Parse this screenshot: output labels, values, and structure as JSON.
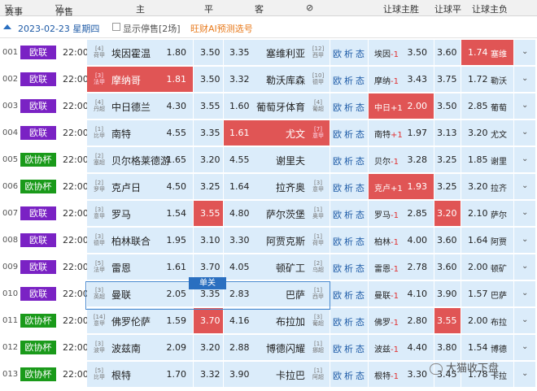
{
  "header": {
    "league": "赛事",
    "stop": "停售",
    "home": "主",
    "draw": "平",
    "away": "客",
    "handicap_col": "⊘",
    "hh_win": "让球主胜",
    "hh_draw": "让球平",
    "hh_lose": "让球主负"
  },
  "datebar": {
    "date": "2023-02-23 星期四",
    "show_stopped": "显示停售[2场]",
    "prediction": "旺财AI预测选号"
  },
  "single_label": "单关",
  "links": {
    "a": "欧",
    "b": "析",
    "c": "态"
  },
  "watermark": "大猫收下盘",
  "matches": [
    {
      "idx": "001",
      "league": "欧联",
      "time": "22:00",
      "home_rank": "[4]",
      "home_league": "荷甲",
      "home": "埃因霍温",
      "home_odd": "1.80",
      "draw": "3.50",
      "away": "塞维利亚",
      "away_odd": "3.35",
      "away_rank": "[12]",
      "away_league": "西甲",
      "h_team": "埃因",
      "h_hcap": "-1",
      "hh": "3.50",
      "hd": "3.60",
      "ha": "1.74",
      "h_away": "塞维"
    },
    {
      "idx": "002",
      "league": "欧联",
      "time": "22:00",
      "home_rank": "[3]",
      "home_league": "法甲",
      "home": "摩纳哥",
      "home_odd": "1.81",
      "draw": "3.50",
      "away": "勒沃库森",
      "away_odd": "3.32",
      "away_rank": "[10]",
      "away_league": "德甲",
      "h_team": "摩纳",
      "h_hcap": "-1",
      "hh": "3.43",
      "hd": "3.75",
      "ha": "1.72",
      "h_away": "勒沃"
    },
    {
      "idx": "003",
      "league": "欧联",
      "time": "22:00",
      "home_rank": "[4]",
      "home_league": "丹超",
      "home": "中日德兰",
      "home_odd": "4.30",
      "draw": "3.55",
      "away": "葡萄牙体育",
      "away_odd": "1.60",
      "away_rank": "[4]",
      "away_league": "葡超",
      "h_team": "中日",
      "h_hcap": "+1",
      "hh": "2.00",
      "hd": "3.50",
      "ha": "2.85",
      "h_away": "葡萄"
    },
    {
      "idx": "004",
      "league": "欧联",
      "time": "22:00",
      "home_rank": "[1]",
      "home_league": "比甲",
      "home": "南特",
      "home_odd": "4.55",
      "draw": "3.35",
      "away": "尤文",
      "away_odd": "1.61",
      "away_rank": "[7]",
      "away_league": "意甲",
      "h_team": "南特",
      "h_hcap": "+1",
      "hh": "1.97",
      "hd": "3.13",
      "ha": "3.20",
      "h_away": "尤文"
    },
    {
      "idx": "005",
      "league": "欧协杯",
      "time": "22:00",
      "home_rank": "[2]",
      "home_league": "塞超",
      "home": "贝尔格莱德游",
      "home_odd": "1.65",
      "draw": "3.20",
      "away": "谢里夫",
      "away_odd": "4.55",
      "away_rank": "",
      "away_league": "",
      "h_team": "贝尔",
      "h_hcap": "-1",
      "hh": "3.28",
      "hd": "3.25",
      "ha": "1.85",
      "h_away": "谢里"
    },
    {
      "idx": "006",
      "league": "欧协杯",
      "time": "22:00",
      "home_rank": "[2]",
      "home_league": "罗甲",
      "home": "克卢日",
      "home_odd": "4.50",
      "draw": "3.25",
      "away": "拉齐奥",
      "away_odd": "1.64",
      "away_rank": "[3]",
      "away_league": "意甲",
      "h_team": "克卢",
      "h_hcap": "+1",
      "hh": "1.93",
      "hd": "3.25",
      "ha": "3.20",
      "h_away": "拉齐"
    },
    {
      "idx": "007",
      "league": "欧联",
      "time": "22:00",
      "home_rank": "[3]",
      "home_league": "意甲",
      "home": "罗马",
      "home_odd": "1.54",
      "draw": "3.55",
      "away": "萨尔茨堡",
      "away_odd": "4.80",
      "away_rank": "[1]",
      "away_league": "奥甲",
      "h_team": "罗马",
      "h_hcap": "-1",
      "hh": "2.85",
      "hd": "3.20",
      "ha": "2.10",
      "h_away": "萨尔"
    },
    {
      "idx": "008",
      "league": "欧联",
      "time": "22:00",
      "home_rank": "[3]",
      "home_league": "德甲",
      "home": "柏林联合",
      "home_odd": "1.95",
      "draw": "3.10",
      "away": "阿贾克斯",
      "away_odd": "3.30",
      "away_rank": "[1]",
      "away_league": "荷甲",
      "h_team": "柏林",
      "h_hcap": "-1",
      "hh": "4.00",
      "hd": "3.60",
      "ha": "1.64",
      "h_away": "阿贾"
    },
    {
      "idx": "009",
      "league": "欧联",
      "time": "22:00",
      "home_rank": "[5]",
      "home_league": "法甲",
      "home": "雷恩",
      "home_odd": "1.61",
      "draw": "3.70",
      "away": "顿矿工",
      "away_odd": "4.05",
      "away_rank": "[2]",
      "away_league": "乌超",
      "h_team": "雷恩",
      "h_hcap": "-1",
      "hh": "2.78",
      "hd": "3.60",
      "ha": "2.00",
      "h_away": "顿矿"
    },
    {
      "idx": "010",
      "league": "欧联",
      "time": "22:00",
      "home_rank": "[3]",
      "home_league": "英超",
      "home": "曼联",
      "home_odd": "2.05",
      "draw": "3.35",
      "away": "巴萨",
      "away_odd": "2.83",
      "away_rank": "[1]",
      "away_league": "西甲",
      "h_team": "曼联",
      "h_hcap": "-1",
      "hh": "4.10",
      "hd": "3.90",
      "ha": "1.57",
      "h_away": "巴萨"
    },
    {
      "idx": "011",
      "league": "欧协杯",
      "time": "22:00",
      "home_rank": "[14]",
      "home_league": "意甲",
      "home": "佛罗伦萨",
      "home_odd": "1.59",
      "draw": "3.70",
      "away": "布拉加",
      "away_odd": "4.16",
      "away_rank": "[3]",
      "away_league": "葡超",
      "h_team": "佛罗",
      "h_hcap": "-1",
      "hh": "2.80",
      "hd": "3.55",
      "ha": "2.00",
      "h_away": "布拉"
    },
    {
      "idx": "012",
      "league": "欧协杯",
      "time": "22:00",
      "home_rank": "[3]",
      "home_league": "波甲",
      "home": "波兹南",
      "home_odd": "2.09",
      "draw": "3.20",
      "away": "博德闪耀",
      "away_odd": "2.88",
      "away_rank": "[1]",
      "away_league": "挪超",
      "h_team": "波兹",
      "h_hcap": "-1",
      "hh": "4.40",
      "hd": "3.80",
      "ha": "1.54",
      "h_away": "博德"
    },
    {
      "idx": "013",
      "league": "欧协杯",
      "time": "22:00",
      "home_rank": "[5]",
      "home_league": "比甲",
      "home": "根特",
      "home_odd": "1.70",
      "draw": "3.32",
      "away": "卡拉巴",
      "away_odd": "3.90",
      "away_rank": "[1]",
      "away_league": "阿超",
      "h_team": "根特",
      "h_hcap": "-1",
      "hh": "3.30",
      "hd": "3.45",
      "ha": "1.78",
      "h_away": "卡拉"
    }
  ],
  "colors": {
    "cell_blue": "#dbecfa",
    "highlight_red": "#e05555",
    "badge_purple": "#7a22c4",
    "badge_green": "#1a9a1a",
    "link_blue": "#1d5aa6"
  }
}
